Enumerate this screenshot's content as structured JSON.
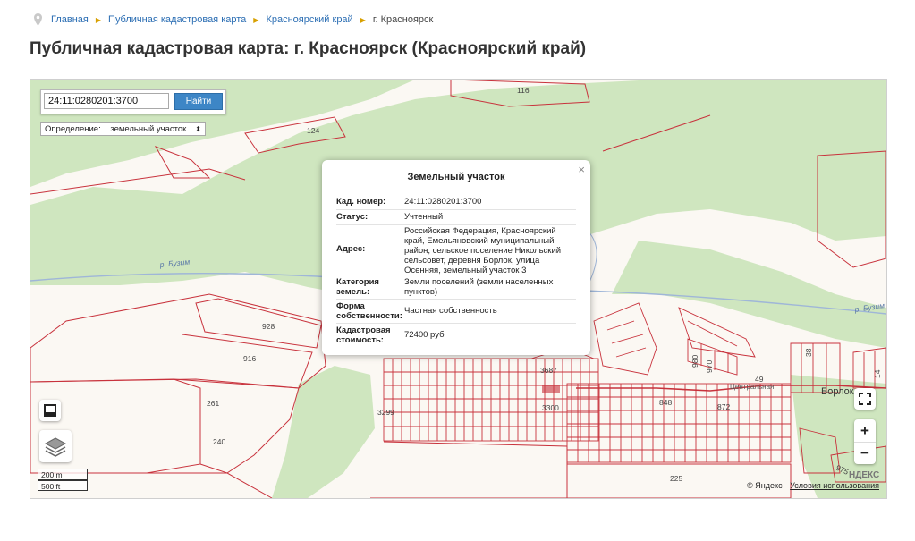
{
  "breadcrumb": {
    "items": [
      "Главная",
      "Публичная кадастровая карта",
      "Красноярский край",
      "г. Красноярск"
    ]
  },
  "page": {
    "title": "Публичная кадастровая карта: г. Красноярск (Красноярский край)"
  },
  "search": {
    "value": "24:11:0280201:3700",
    "button": "Найти"
  },
  "definition": {
    "label": "Определение:",
    "value": "земельный участок"
  },
  "popup": {
    "title": "Земельный участок",
    "close": "×",
    "rows": [
      {
        "key": "Кад. номер:",
        "value": "24:11:0280201:3700"
      },
      {
        "key": "Статус:",
        "value": "Учтенный"
      },
      {
        "key": "Адрес:",
        "value": "Российская Федерация, Красноярский край, Емельяновский муниципальный район, сельское поселение Никольский сельсовет, деревня Борлок, улица Осенняя, земельный участок 3"
      },
      {
        "key": "Категория земель:",
        "value": "Земли поселений (земли населенных пунктов)"
      },
      {
        "key": "Форма собственности:",
        "value": "Частная собственность"
      },
      {
        "key": "Кадастровая стоимость:",
        "value": "72400 руб"
      }
    ]
  },
  "map": {
    "parcel_labels": [
      "116",
      "124",
      "928",
      "916",
      "261",
      "240",
      "3299",
      "3300",
      "3687",
      "848",
      "872",
      "49",
      "980",
      "970",
      "38",
      "14",
      "975",
      "225"
    ],
    "river_label": "р. Бузим",
    "river_label_right": "р. Бузим",
    "village_label": "Борлок",
    "street_label": "Центральная",
    "zoom_in": "+",
    "zoom_out": "−",
    "scale_m": "200 m",
    "scale_ft": "500 ft",
    "copyright": "© Яндекс",
    "terms": "Условия использования",
    "yandex_mark": "НДЕКС",
    "colors": {
      "parcel_line": "#c8323c",
      "forest": "#cfe6bf",
      "river": "#9fb6d8",
      "field": "#fbf8f3"
    }
  }
}
